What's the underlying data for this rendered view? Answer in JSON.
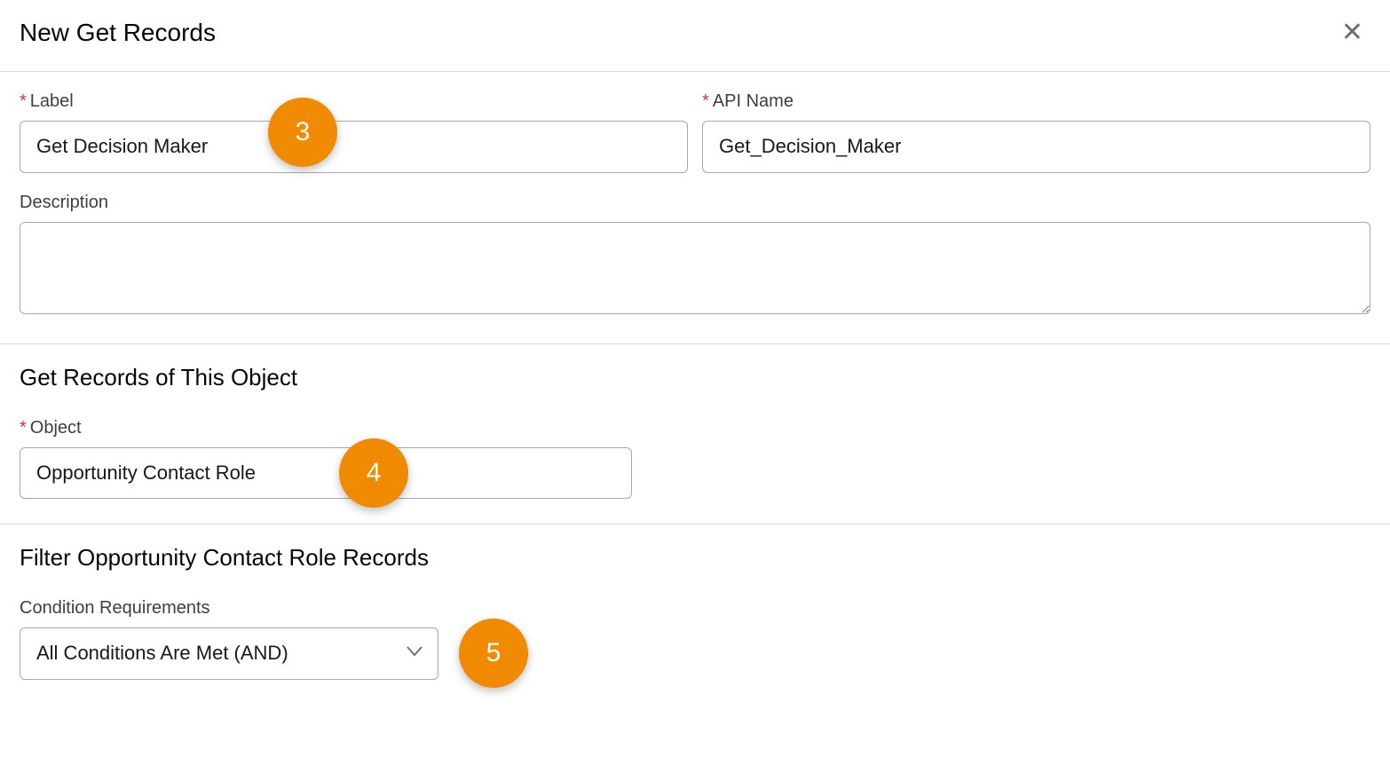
{
  "header": {
    "title": "New Get Records"
  },
  "fields": {
    "label": {
      "label": "Label",
      "value": "Get Decision Maker"
    },
    "apiName": {
      "label": "API Name",
      "value": "Get_Decision_Maker"
    },
    "description": {
      "label": "Description",
      "value": ""
    }
  },
  "objectSection": {
    "heading": "Get Records of This Object",
    "objectLabel": "Object",
    "objectValue": "Opportunity Contact Role"
  },
  "filterSection": {
    "heading": "Filter Opportunity Contact Role Records",
    "conditionLabel": "Condition Requirements",
    "conditionValue": "All Conditions Are Met (AND)"
  },
  "callouts": {
    "c3": "3",
    "c4": "4",
    "c5": "5"
  }
}
